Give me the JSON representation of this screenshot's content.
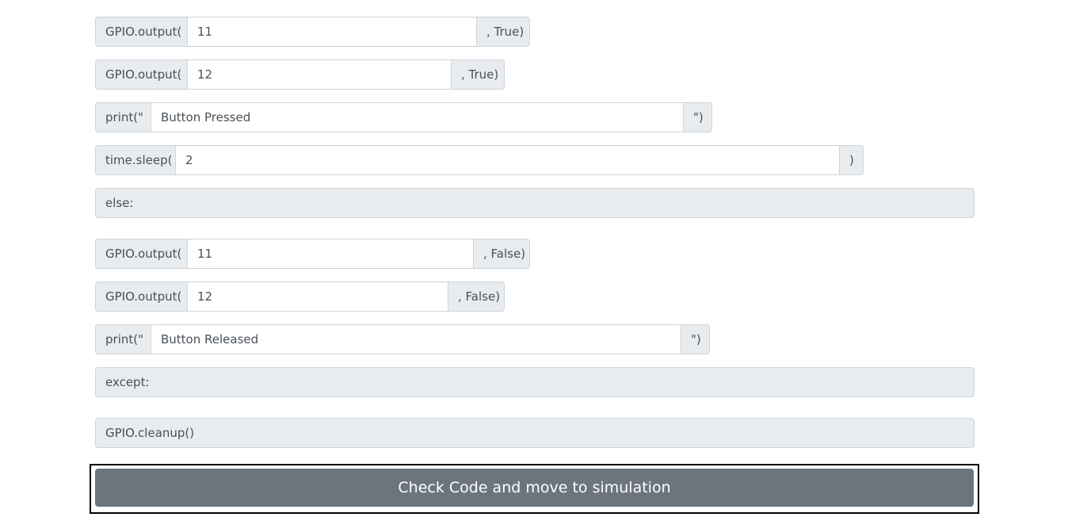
{
  "lines": [
    {
      "prefix": "GPIO.output(",
      "value": "11",
      "suffix": ", True)"
    },
    {
      "prefix": "GPIO.output(",
      "value": "12",
      "suffix": ", True)"
    },
    {
      "prefix": "print(\"",
      "value": "Button Pressed",
      "suffix": "\")"
    },
    {
      "prefix": "time.sleep(",
      "value": "2",
      "suffix": ")"
    },
    {
      "label": "else:"
    },
    {
      "prefix": "GPIO.output(",
      "value": "11",
      "suffix": ", False)"
    },
    {
      "prefix": "GPIO.output(",
      "value": "12",
      "suffix": ", False)"
    },
    {
      "prefix": "print(\"",
      "value": "Button Released",
      "suffix": "\")"
    },
    {
      "label": "except:"
    },
    {
      "label": "GPIO.cleanup()"
    }
  ],
  "submit_label": "Check Code and move to simulation",
  "colors": {
    "addon_bg": "#e9ecef",
    "border": "#ced4da",
    "button_bg": "#6c757d",
    "button_text": "#ffffff"
  }
}
